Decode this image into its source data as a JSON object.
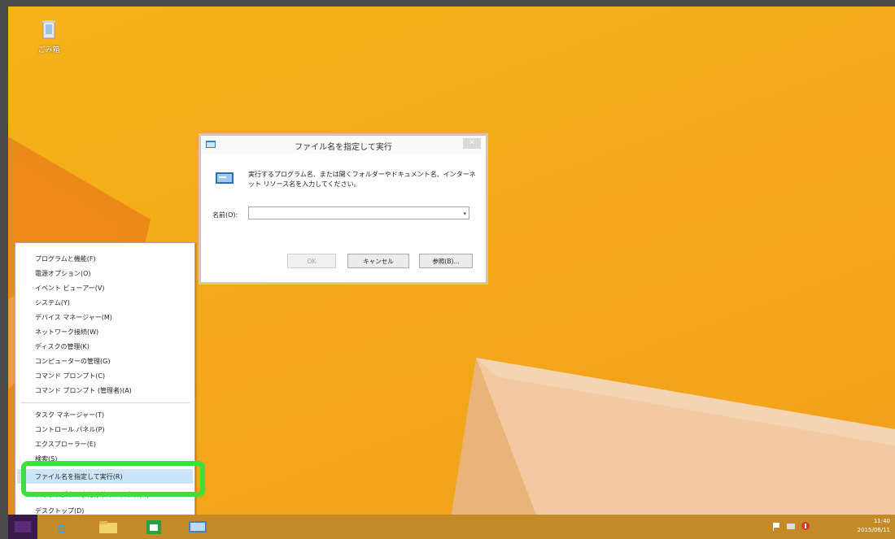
{
  "desktop": {
    "recycle_bin_label": "ごみ箱",
    "recycle_bin_icon": "recycle-bin-icon"
  },
  "run_dialog": {
    "title": "ファイル名を指定して実行",
    "close_symbol": "✕",
    "description": "実行するプログラム名、または開くフォルダーやドキュメント名、インターネット リソース名を入力してください。",
    "name_label": "名前(O):",
    "name_value": "",
    "ok_label": "OK",
    "cancel_label": "キャンセル",
    "browse_label": "参照(B)..."
  },
  "context_menu": {
    "items": [
      "プログラムと機能(F)",
      "電源オプション(O)",
      "イベント ビューアー(V)",
      "システム(Y)",
      "デバイス マネージャー(M)",
      "ネットワーク接続(W)",
      "ディスクの管理(K)",
      "コンピューターの管理(G)",
      "コマンド プロンプト(C)",
      "コマンド プロンプト (管理者)(A)",
      "タスク マネージャー(T)",
      "コントロール パネル(P)",
      "エクスプローラー(E)",
      "検索(S)",
      "ファイル名を指定して実行(R)",
      "シャットダウンまたはサインアウト(U)",
      "デスクトップ(D)"
    ],
    "highlighted_index": 14,
    "highlight_color": "#3de03a"
  },
  "taskbar": {
    "apps": [
      "internet-explorer-icon",
      "file-explorer-icon",
      "store-icon",
      "run-icon"
    ],
    "clock_time": "11:40",
    "clock_date": "2015/06/11"
  },
  "colors": {
    "wallpaper": "#f4a91a",
    "taskbar": "#c48a28",
    "start_button": "#3a1a4a"
  }
}
